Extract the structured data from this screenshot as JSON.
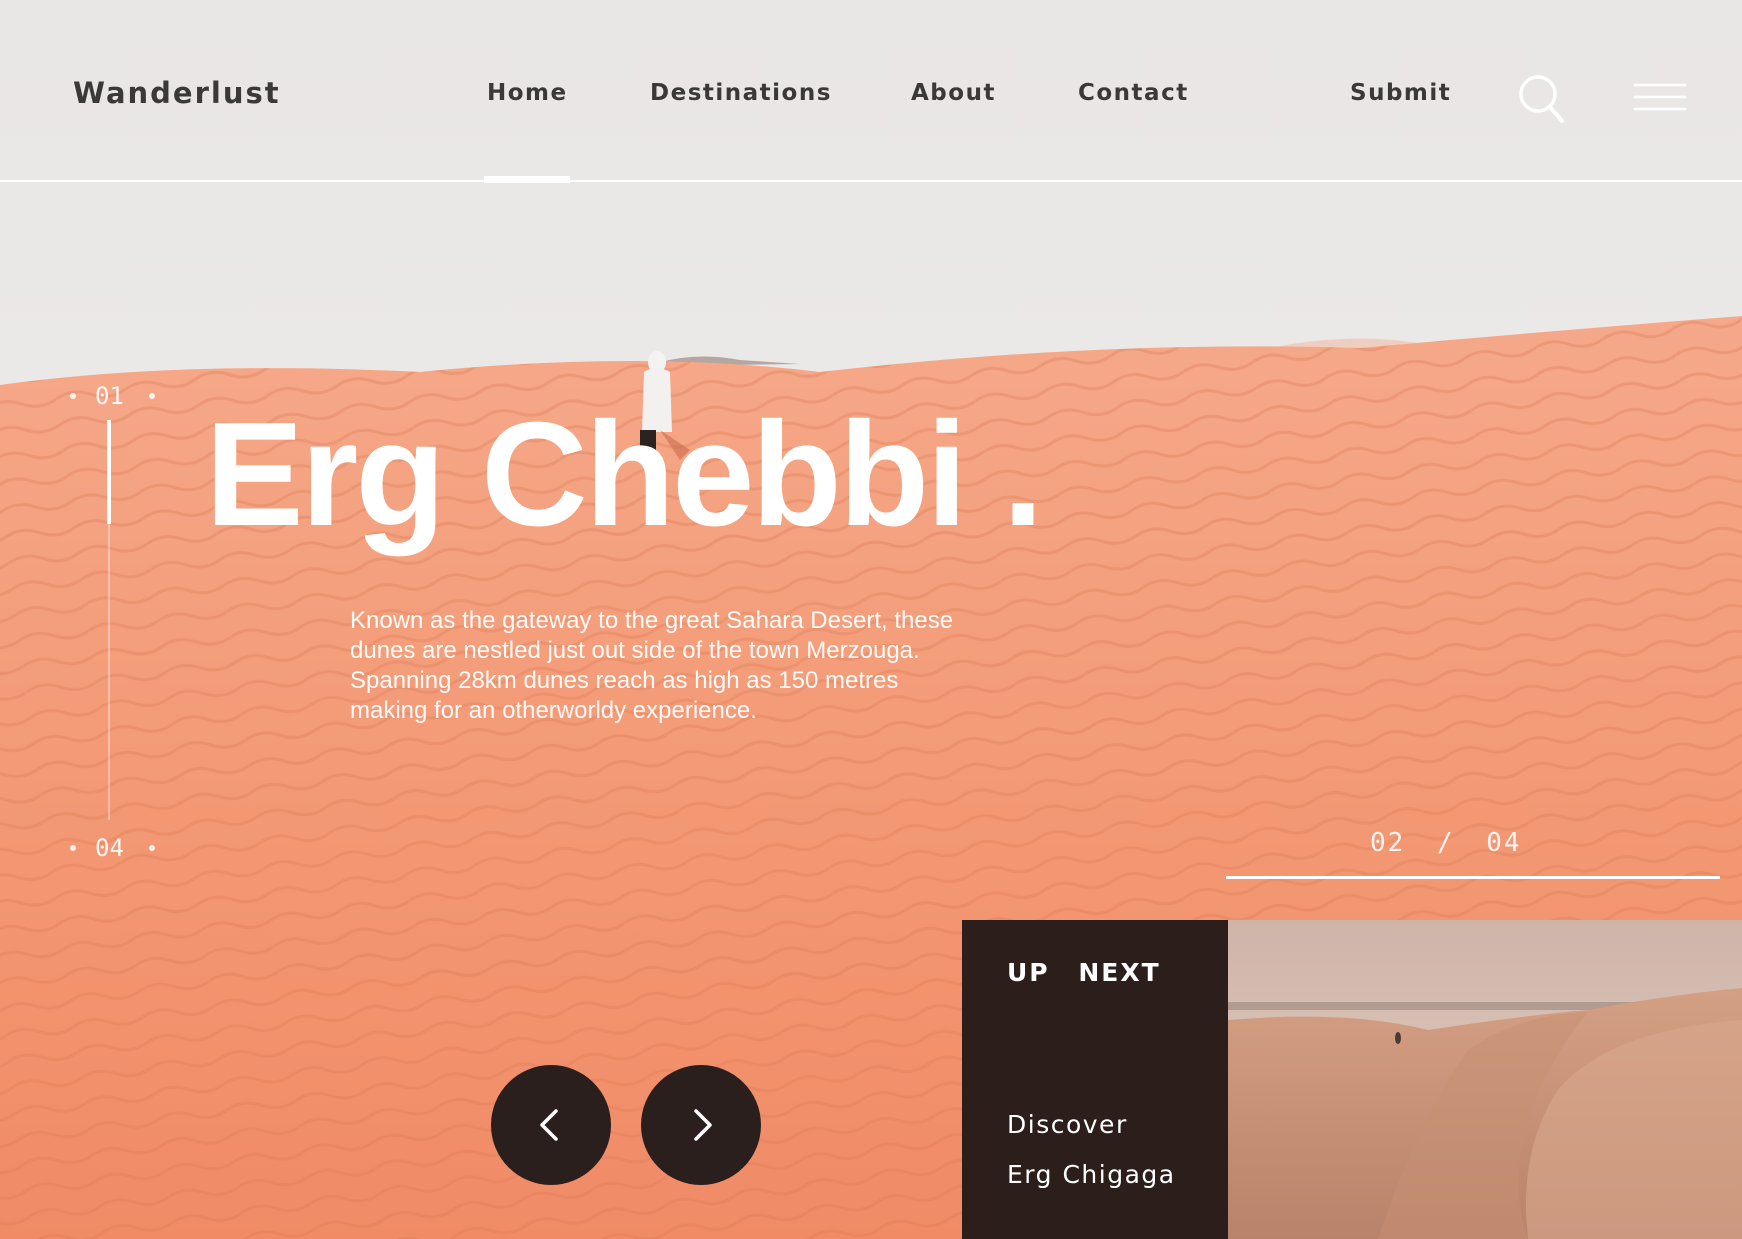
{
  "site": {
    "logo": "Wanderlust"
  },
  "nav": {
    "items": [
      {
        "label": "Home",
        "active": true
      },
      {
        "label": "Destinations",
        "active": false
      },
      {
        "label": "About",
        "active": false
      },
      {
        "label": "Contact",
        "active": false
      }
    ],
    "submit_label": "Submit",
    "icons": {
      "search": "search-icon",
      "menu": "hamburger-menu-icon"
    }
  },
  "indicator": {
    "start": "01",
    "end": "04"
  },
  "hero": {
    "title": "Erg Chebbi .",
    "description_lines": [
      "Known as the gateway to the great Sahara Desert, these",
      "dunes are nestled just out side of the town Merzouga.",
      "Spanning 28km dunes reach as high as 150 metres",
      "making for an otherworldy experience."
    ]
  },
  "counter": {
    "current": "02",
    "separator": "/",
    "total": "04",
    "progress": 0.5
  },
  "controls": {
    "prev_icon": "chevron-left-icon",
    "next_icon": "chevron-right-icon"
  },
  "up_next": {
    "label": "UP NEXT",
    "line1": "Discover",
    "line2": "Erg Chigaga"
  },
  "colors": {
    "sand": "#f39b78",
    "sky": "#ece8e6",
    "dark": "#2b1e1b",
    "nav_text": "#3b3838",
    "white": "#ffffff"
  }
}
